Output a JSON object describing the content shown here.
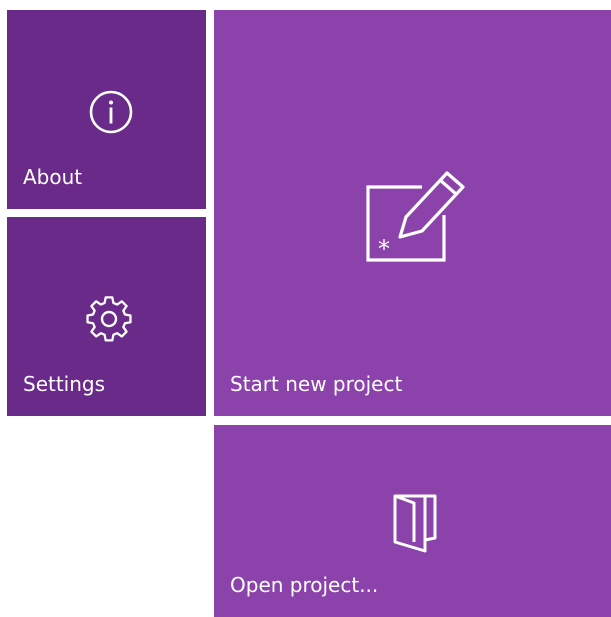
{
  "colors": {
    "tile_dark": "#6a2a8a",
    "tile_light": "#8c42ab",
    "background": "#ffffff",
    "foreground": "#ffffff"
  },
  "tiles": {
    "about": {
      "label": "About",
      "icon": "info-icon"
    },
    "settings": {
      "label": "Settings",
      "icon": "gear-icon"
    },
    "start_new_project": {
      "label": "Start new project",
      "icon": "new-project-edit-icon"
    },
    "open_project": {
      "label": "Open project...",
      "icon": "open-folder-door-icon"
    }
  }
}
